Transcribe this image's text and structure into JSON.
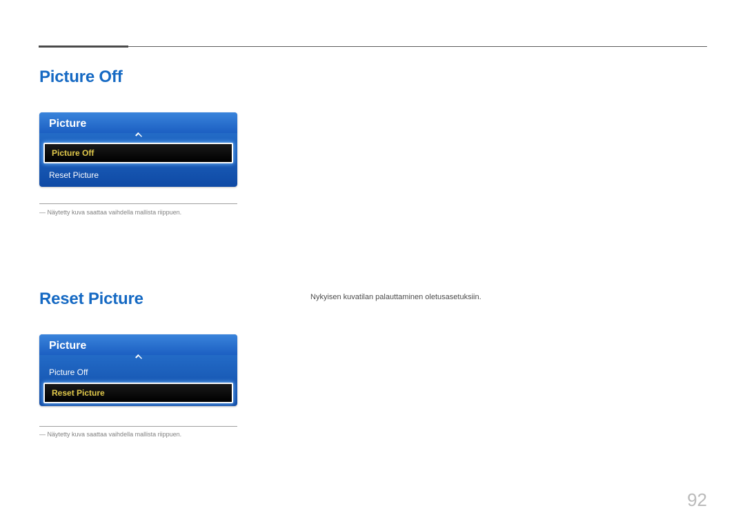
{
  "page": {
    "number": "92"
  },
  "section1": {
    "title": "Picture Off",
    "menu_title": "Picture",
    "item_selected": "Picture Off",
    "item_below": "Reset Picture",
    "footnote": "―  Näytetty kuva saattaa vaihdella mallista riippuen."
  },
  "section2": {
    "title": "Reset Picture",
    "body": "Nykyisen kuvatilan palauttaminen oletusasetuksiin.",
    "menu_title": "Picture",
    "item_above": "Picture Off",
    "item_selected": "Reset Picture",
    "footnote": "―  Näytetty kuva saattaa vaihdella mallista riippuen."
  }
}
